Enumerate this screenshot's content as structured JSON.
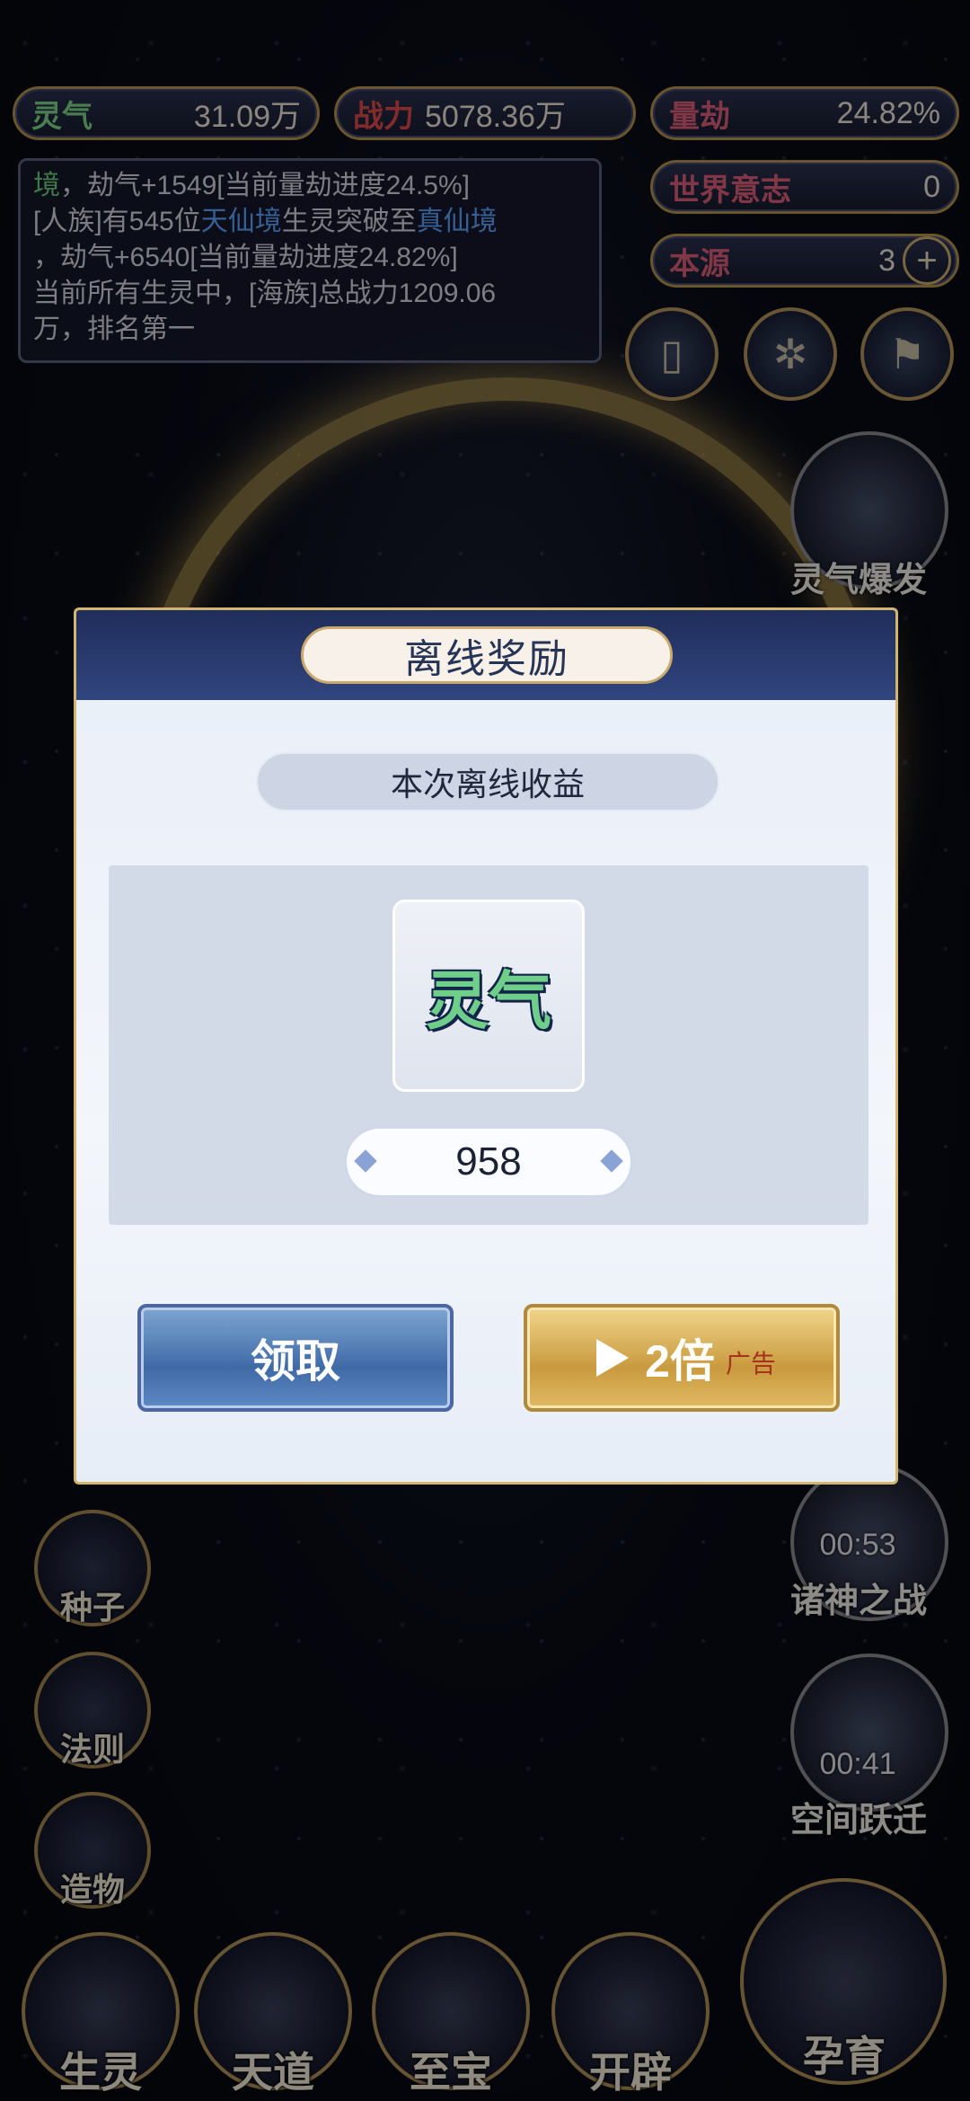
{
  "stats": {
    "lingqi": {
      "label": "灵气",
      "value": "31.09万"
    },
    "zhanli": {
      "label": "战力",
      "value": "5078.36万"
    },
    "liangjie": {
      "label": "量劫",
      "value": "24.82%"
    },
    "world_will": {
      "label": "世界意志",
      "value": "0"
    },
    "benyuan": {
      "label": "本源",
      "value": "3",
      "plus": "+"
    }
  },
  "log": {
    "line1": {
      "a": "境",
      "b": "，劫气+1549[当前量劫进度24.5%]"
    },
    "line2": {
      "a": "[人族]有545位",
      "b": "天仙境",
      "c": "生灵突破至",
      "d": "真仙境"
    },
    "line3": "，劫气+6540[当前量劫进度24.82%]",
    "line4": "当前所有生灵中，[海族]总战力1209.06",
    "line5": "万，排名第一"
  },
  "right_buttons": {
    "burst": "灵气爆发",
    "battle": {
      "label": "诸神之战",
      "timer": "00:53"
    },
    "jump": {
      "label": "空间跃迁",
      "timer": "00:41"
    }
  },
  "side_menu": [
    "种子",
    "法则",
    "造物"
  ],
  "bottom_nav": [
    "生灵",
    "天道",
    "至宝",
    "开辟",
    "孕育"
  ],
  "dialog": {
    "title": "离线奖励",
    "subtitle": "本次离线收益",
    "reward": {
      "name": "灵气",
      "amount": "958"
    },
    "claim_label": "领取",
    "double_label": "2倍",
    "ad_label": "广告"
  }
}
